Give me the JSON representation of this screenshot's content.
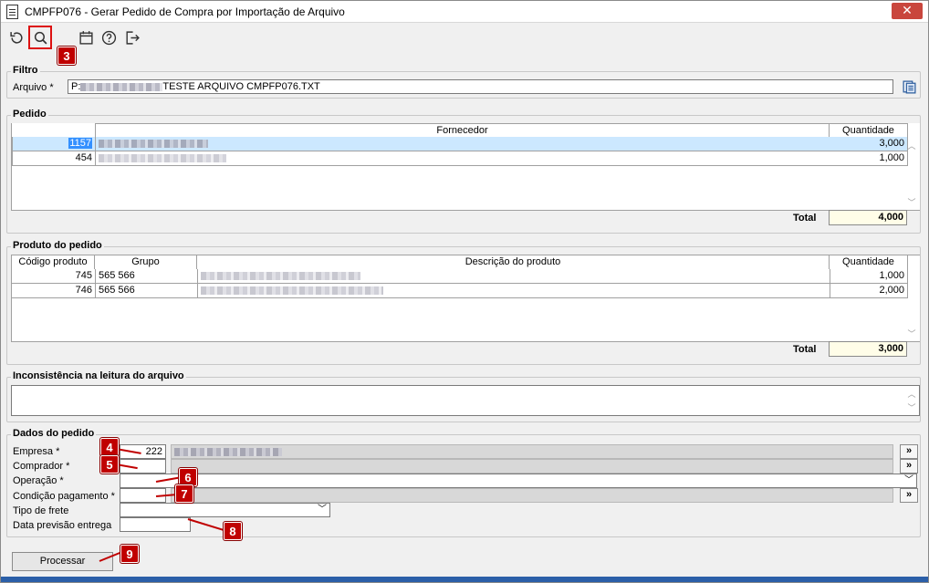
{
  "window": {
    "title": "CMPFP076 - Gerar Pedido de Compra por Importação de Arquivo",
    "close_label": "✕"
  },
  "toolbar": {
    "buttons": [
      "undo-icon",
      "search-icon",
      "calendar-icon",
      "help-icon",
      "exit-icon"
    ]
  },
  "badges": {
    "b3": "3",
    "b4": "4",
    "b5": "5",
    "b6": "6",
    "b7": "7",
    "b8": "8",
    "b9": "9"
  },
  "filtro": {
    "label": "Filtro",
    "arquivo_label": "Arquivo *",
    "arquivo_prefix": "P:",
    "arquivo_suffix": "TESTE ARQUIVO CMPFP076.TXT"
  },
  "pedido": {
    "label": "Pedido",
    "headers": {
      "fornecedor": "Fornecedor",
      "quantidade": "Quantidade"
    },
    "rows": [
      {
        "code": "1157",
        "quantidade": "3,000"
      },
      {
        "code": "454",
        "quantidade": "1,000"
      }
    ],
    "total_label": "Total",
    "total_value": "4,000"
  },
  "produto": {
    "label": "Produto do pedido",
    "headers": {
      "codigo": "Código produto",
      "grupo": "Grupo",
      "descricao": "Descrição do produto",
      "quantidade": "Quantidade"
    },
    "rows": [
      {
        "codigo": "745",
        "grupo": "565 566",
        "quantidade": "1,000"
      },
      {
        "codigo": "746",
        "grupo": "565 566",
        "quantidade": "2,000"
      }
    ],
    "total_label": "Total",
    "total_value": "3,000"
  },
  "inconsistencia": {
    "label": "Inconsistência na leitura do arquivo"
  },
  "dados": {
    "label": "Dados do pedido",
    "empresa_label": "Empresa *",
    "empresa_value": "222",
    "comprador_label": "Comprador *",
    "operacao_label": "Operação *",
    "condicao_label": "Condição pagamento *",
    "frete_label": "Tipo de frete",
    "data_label": "Data previsão entrega",
    "more_label": "»"
  },
  "process_label": "Processar"
}
